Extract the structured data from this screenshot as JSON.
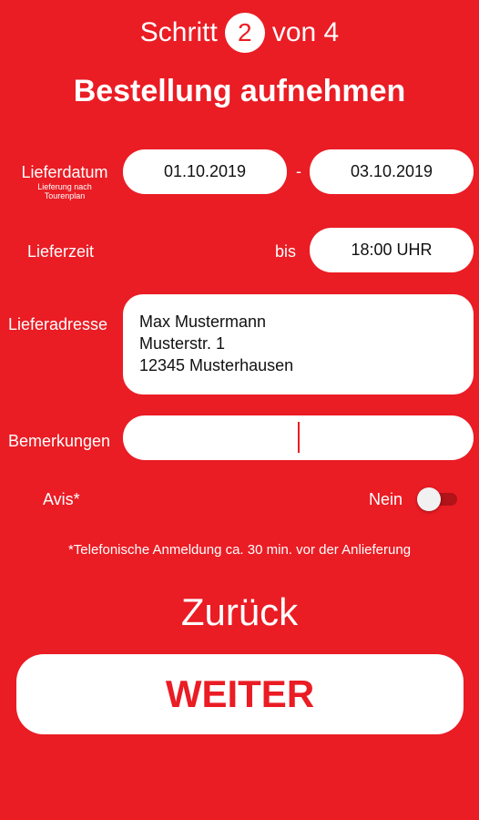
{
  "header": {
    "step_prefix": "Schritt",
    "step_number": "2",
    "step_suffix": "von 4",
    "title": "Bestellung aufnehmen"
  },
  "delivery_date": {
    "label": "Lieferdatum",
    "sublabel_line1": "Lieferung nach",
    "sublabel_line2": "Tourenplan",
    "from": "01.10.2019",
    "separator": "-",
    "to": "03.10.2019"
  },
  "delivery_time": {
    "label": "Lieferzeit",
    "until_label": "bis",
    "value": "18:00 UHR"
  },
  "delivery_address": {
    "label": "Lieferadresse",
    "line1": "Max Mustermann",
    "line2": "Musterstr. 1",
    "line3": "12345 Musterhausen"
  },
  "remarks": {
    "label": "Bemerkungen",
    "value": ""
  },
  "avis": {
    "label": "Avis*",
    "toggle_state_label": "Nein",
    "enabled": false
  },
  "footnote": "*Telefonische Anmeldung ca. 30 min. vor der Anlieferung",
  "actions": {
    "back_label": "Zurück",
    "next_label": "WEITER"
  },
  "colors": {
    "background": "#ea1c24",
    "surface": "#ffffff",
    "accent_text": "#ea1c24"
  }
}
